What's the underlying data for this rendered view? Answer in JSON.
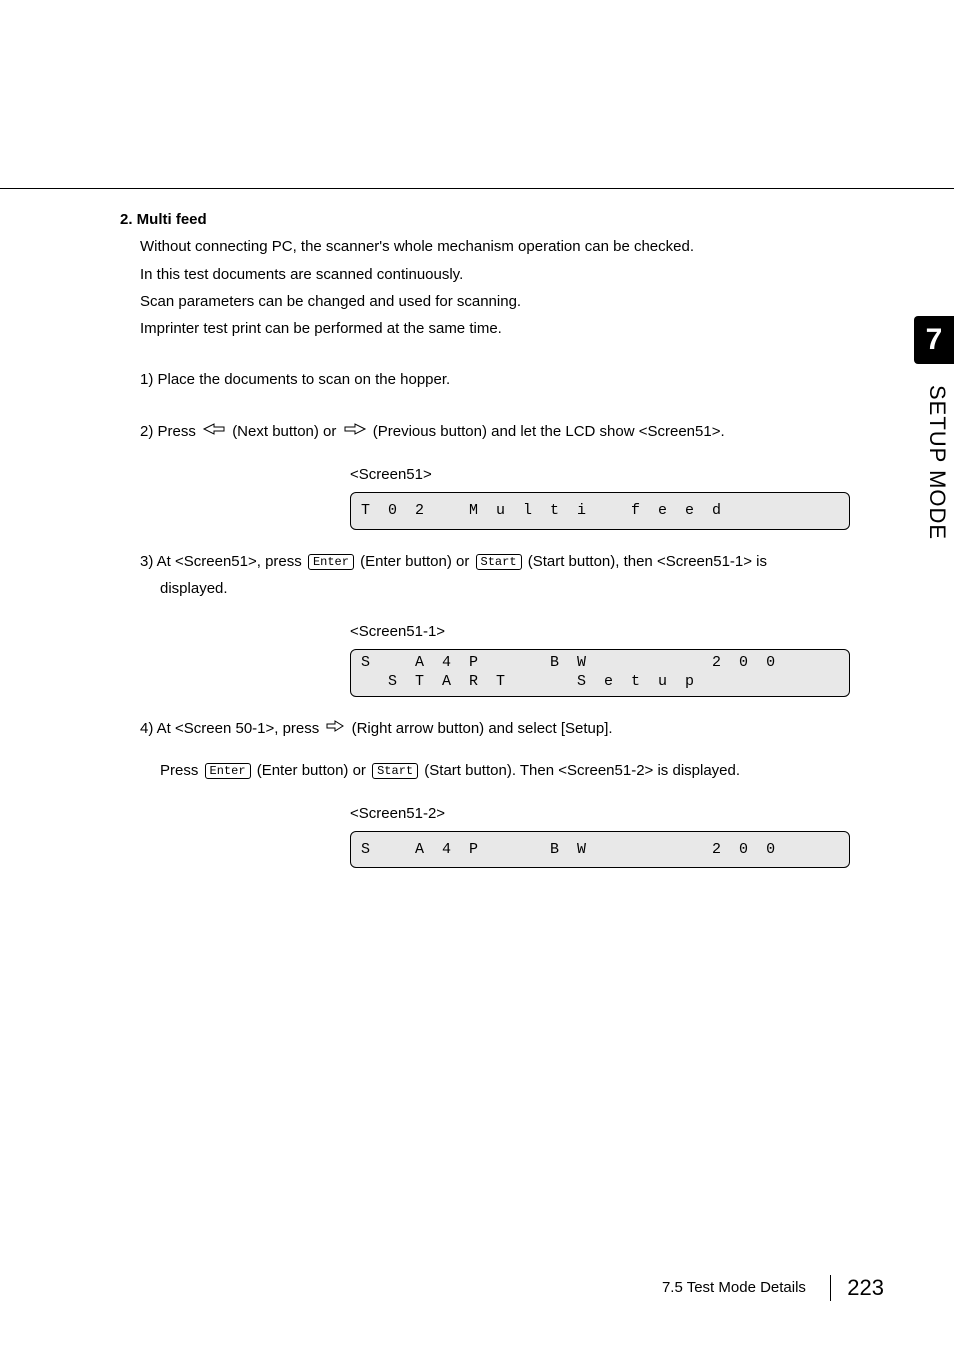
{
  "heading": {
    "title": "2. Multi feed"
  },
  "intro": {
    "l1": "Without connecting PC, the scanner's whole mechanism operation can be checked.",
    "l2": "In this test documents are scanned continuously.",
    "l3": "Scan parameters can be changed and used for scanning.",
    "l4": "Imprinter test print can be performed at the same time."
  },
  "step1": "1) Place the documents to scan on the hopper.",
  "step2": {
    "a": "2) Press ",
    "b": "(Next button) or ",
    "c": " (Previous button) and let the LCD show <Screen51>."
  },
  "screen51": {
    "caption": "<Screen51>",
    "row": "T  0  2     M  u  l  t  i     f  e  e  d"
  },
  "step3": {
    "a": "3) At <Screen51>, press ",
    "enter_label": "Enter",
    "b": " (Enter button) or ",
    "start_label": "Start",
    "c": " (Start button), then <Screen51-1> is",
    "d": "displayed."
  },
  "screen51_1": {
    "caption": "<Screen51-1>",
    "row1": "S     A  4  P        B  W              2  0  0",
    "row2": "   S  T  A  R  T        S  e  t  u  p"
  },
  "step4": {
    "a": "4) At <Screen 50-1>, press ",
    "b": "(Right arrow button) and select [Setup].",
    "c": "Press ",
    "enter_label": "Enter",
    "d": " (Enter button) or ",
    "start_label": "Start",
    "e": " (Start button). Then <Screen51-2> is displayed."
  },
  "screen51_2": {
    "caption": "<Screen51-2>",
    "row": "S     A  4  P        B  W              2  0  0"
  },
  "side": {
    "chapter": "7",
    "label": "SETUP MODE"
  },
  "footer": {
    "section": "7.5  Test Mode Details",
    "page": "223"
  }
}
